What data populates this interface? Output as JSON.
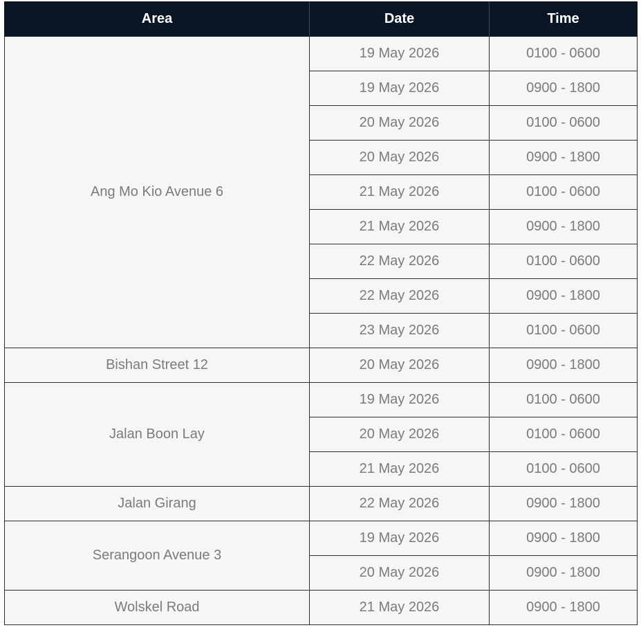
{
  "headers": {
    "area": "Area",
    "date": "Date",
    "time": "Time"
  },
  "groups": [
    {
      "area": "Ang Mo Kio Avenue 6",
      "rows": [
        {
          "date": "19 May 2026",
          "time": "0100 - 0600"
        },
        {
          "date": "19 May 2026",
          "time": "0900 - 1800"
        },
        {
          "date": "20 May 2026",
          "time": "0100 - 0600"
        },
        {
          "date": "20 May 2026",
          "time": "0900 - 1800"
        },
        {
          "date": "21 May 2026",
          "time": "0100 - 0600"
        },
        {
          "date": "21 May 2026",
          "time": "0900 - 1800"
        },
        {
          "date": "22 May 2026",
          "time": "0100 - 0600"
        },
        {
          "date": "22 May 2026",
          "time": "0900 - 1800"
        },
        {
          "date": "23 May 2026",
          "time": "0100 - 0600"
        }
      ]
    },
    {
      "area": "Bishan Street 12",
      "rows": [
        {
          "date": "20 May 2026",
          "time": "0900 - 1800"
        }
      ]
    },
    {
      "area": "Jalan Boon Lay",
      "rows": [
        {
          "date": "19 May 2026",
          "time": "0100 - 0600"
        },
        {
          "date": "20 May 2026",
          "time": "0100 - 0600"
        },
        {
          "date": "21 May 2026",
          "time": "0100 - 0600"
        }
      ]
    },
    {
      "area": "Jalan Girang",
      "rows": [
        {
          "date": "22 May 2026",
          "time": "0900 - 1800"
        }
      ]
    },
    {
      "area": "Serangoon Avenue 3",
      "rows": [
        {
          "date": "19 May 2026",
          "time": "0900 - 1800"
        },
        {
          "date": "20 May 2026",
          "time": "0900 - 1800"
        }
      ]
    },
    {
      "area": "Wolskel Road",
      "rows": [
        {
          "date": "21 May 2026",
          "time": "0900 - 1800"
        }
      ]
    }
  ]
}
